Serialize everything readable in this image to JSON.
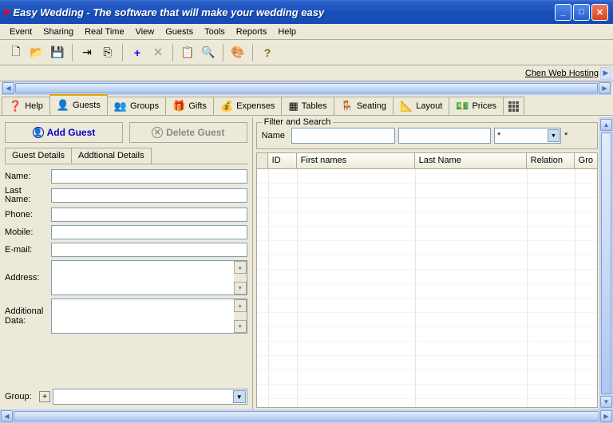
{
  "window": {
    "title": "Easy Wedding - The software that will make your wedding easy"
  },
  "menu": {
    "items": [
      "Event",
      "Sharing",
      "Real Time",
      "View",
      "Guests",
      "Tools",
      "Reports",
      "Help"
    ]
  },
  "toolbar_icons": [
    "📄",
    "📂",
    "💾",
    "↦",
    "⎘",
    "+",
    "✕",
    "📋",
    "🔎",
    "🎨",
    "?"
  ],
  "subbar": {
    "hosting": "Chen Web Hosting"
  },
  "main_tabs": [
    {
      "icon": "?",
      "label": "Help"
    },
    {
      "icon": "👤",
      "label": "Guests"
    },
    {
      "icon": "👥",
      "label": "Groups"
    },
    {
      "icon": "🎁",
      "label": "Gifts"
    },
    {
      "icon": "💰",
      "label": "Expenses"
    },
    {
      "icon": "▦",
      "label": "Tables"
    },
    {
      "icon": "🪑",
      "label": "Seating"
    },
    {
      "icon": "📐",
      "label": "Layout"
    },
    {
      "icon": "💵",
      "label": "Prices"
    }
  ],
  "left": {
    "add_label": "Add Guest",
    "delete_label": "Delete Guest",
    "sub_tabs": [
      "Guest Details",
      "Addtional Details"
    ],
    "fields": {
      "name": "Name:",
      "last_name": "Last Name:",
      "phone": "Phone:",
      "mobile": "Mobile:",
      "email": "E-mail:",
      "address": "Address:",
      "additional": "Additional Data:",
      "group": "Group:"
    }
  },
  "filter": {
    "legend": "Filter and Search",
    "name_label": "Name",
    "combo_value": "*",
    "extra": "*"
  },
  "grid": {
    "columns": [
      "ID",
      "First names",
      "Last Name",
      "Relation",
      "Gro"
    ]
  }
}
